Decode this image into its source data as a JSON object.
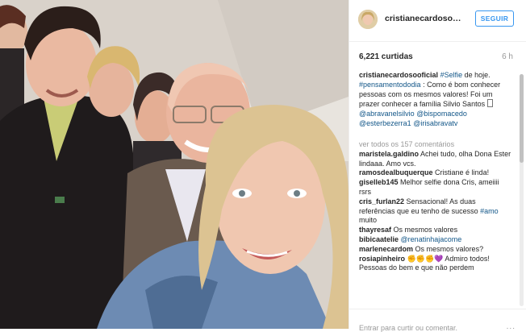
{
  "post": {
    "username": "cristianecardosooficial",
    "username_header": "cristianecardosoofic...",
    "follow_label": "SEGUIR",
    "likes": "6,221 curtidas",
    "time": "6 h",
    "caption_parts": {
      "p1": "#Selfie",
      "p2": " de hoje. ",
      "p3": "#pensamentododia",
      "p4": " : Como é bom conhecer pessoas com os mesmos valores! Foi um prazer conhecer a família Silvio Santos ",
      "p5": "@abravanelsilvio",
      "p6": "@bispomacedo",
      "p7": "@esterbezerra1",
      "p8": "@irisabravatv"
    },
    "view_all": "ver todos os 157 comentários",
    "comments": [
      {
        "user": "maristela.galdino",
        "text": "Achei tudo, olha Dona Ester lindaaa. Amo vcs."
      },
      {
        "user": "ramosdealbuquerque",
        "text": "Cristiane é linda!"
      },
      {
        "user": "giselleb145",
        "text": "Melhor selfie dona Cris, ameiiii rsrs"
      },
      {
        "user": "cris_furlan22",
        "text": "Sensacional! As duas referências que eu tenho de sucesso "
      },
      {
        "user": "thayresaf",
        "text": "Os mesmos valores"
      },
      {
        "user": "bibicaatelie",
        "text": "@renatinhajacome"
      },
      {
        "user": "marlenecardom",
        "text": "Os mesmos valores?"
      },
      {
        "user": "rosiapinheiro",
        "text": "Admiro todos! Pessoas do bem e que não perdem"
      }
    ],
    "comment3_tag": "#amo",
    "comment3_tail": " muito",
    "comment8_emoji": "✊✊✊💜",
    "footer_placeholder": "Entrar para curtir ou comentar.",
    "more_icon": "..."
  },
  "colors": {
    "link": "#125688",
    "follow": "#3897f0",
    "muted": "#999999"
  }
}
